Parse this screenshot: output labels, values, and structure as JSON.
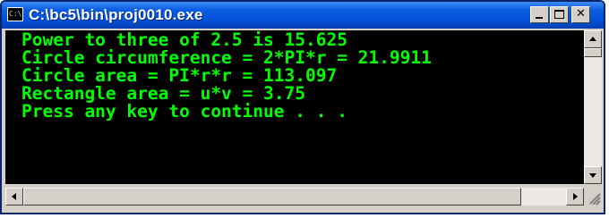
{
  "window": {
    "title": "C:\\bc5\\bin\\proj0010.exe",
    "icon_label": "C:\\"
  },
  "console": {
    "lines": [
      "Power to three of 2.5 is 15.625",
      "Circle circumference = 2*PI*r = 21.9911",
      "Circle area = PI*r*r = 113.097",
      "Rectangle area = u*v = 3.75",
      "Press any key to continue . . ."
    ],
    "text_color": "#00ff00",
    "background": "#000000"
  },
  "controls": {
    "minimize_icon": "minimize-icon",
    "maximize_icon": "maximize-icon",
    "close_glyph": "✕"
  }
}
